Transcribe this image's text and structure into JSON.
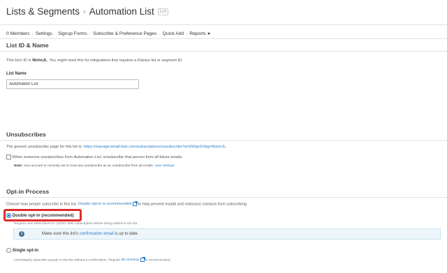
{
  "breadcrumb": {
    "root": "Lists & Segments",
    "separator": "›",
    "current": "Automation List",
    "badge": "List"
  },
  "tabs": [
    "0 Members",
    "Settings",
    "Signup Forms",
    "Subscribe & Preference Pages",
    "Quick Add",
    "Reports"
  ],
  "list_id_section": {
    "title": "List ID & Name",
    "desc_prefix": "This list's ID is ",
    "list_id": "WzhnJL",
    "desc_suffix": ". You might need this for integrations that requires a Klaviyo list or segment ID.",
    "name_label": "List Name",
    "name_value": "Automation List"
  },
  "unsubscribes": {
    "title": "Unsubscribes",
    "desc_prefix": "The generic unsubscribe page for this list is: ",
    "url": "https://manage.kmail-lists.com/subscriptions/unsubscribe?a=KWqeSX&g=WzhnJL",
    "desc_suffix": ".",
    "checkbox_prefix": "When someone unsubscribes from ",
    "checkbox_list": "Automation List",
    "checkbox_suffix": ", unsubscribe that person from all future emails.",
    "checkbox_checked": false,
    "note_label": "Note:",
    "note_text": " Your account is currently set to treat any unsubscribe as an unsubscribe from all emails. ",
    "note_link": "View settings"
  },
  "optin": {
    "title": "Opt-in Process",
    "desc_prefix": "Choose how people subscribe to this list. ",
    "desc_link": "Double opt-in is recommended",
    "desc_suffix": " to help prevent invalid and malicious contacts from subscribing.",
    "double_label": "Double opt-in (recommended)",
    "double_selected": true,
    "double_desc": "Require new subscribers to confirm their subscription before being added to the list.",
    "info_prefix": "Make sure this list's ",
    "info_link": "confirmation email",
    "info_suffix": " is up to date.",
    "single_label": "Single opt-in",
    "single_selected": false,
    "single_desc_prefix": "Immediately subscribe people to this list without a confirmation. Regular ",
    "single_desc_link": "list cleaning",
    "single_desc_suffix": " is recommended."
  },
  "colors": {
    "link": "#2b7ec7",
    "highlight": "#e02b2b",
    "info_bg": "#eef6fc",
    "radio_selected": "#1f6fbf"
  },
  "icons": [
    "chevron-right-icon",
    "caret-down-icon",
    "info-icon",
    "external-link-icon"
  ]
}
